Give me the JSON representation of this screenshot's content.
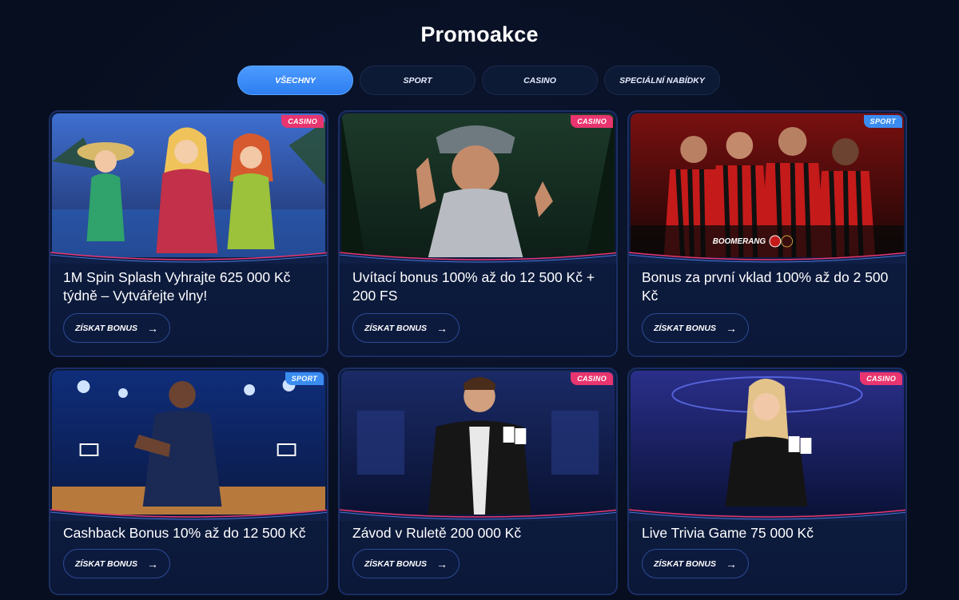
{
  "page": {
    "title": "Promoakce"
  },
  "tabs": [
    {
      "label": "VŠECHNY",
      "active": true
    },
    {
      "label": "SPORT",
      "active": false
    },
    {
      "label": "CASINO",
      "active": false
    },
    {
      "label": "SPECIÁLNÍ NABÍDKY",
      "active": false
    }
  ],
  "cards": [
    {
      "badge": "CASINO",
      "title": "1M Spin Splash Vyhrajte 625 000 Kč týdně – Vytvářejte vlny!",
      "cta": "ZÍSKAT BONUS",
      "image": "three-women-pool-party"
    },
    {
      "badge": "CASINO",
      "title": "Uvítací bonus 100% až do 12 500 Kč + 200 FS",
      "cta": "ZÍSKAT BONUS",
      "image": "conquistador-thumbs-up"
    },
    {
      "badge": "SPORT",
      "title": "Bonus za první vklad 100% až do 2 500 Kč",
      "cta": "ZÍSKAT BONUS",
      "image": "football-players-red-black",
      "logo_text": "BOOMERANG"
    },
    {
      "badge": "SPORT",
      "title": "Cashback Bonus 10% až do 12 500 Kč",
      "cta": "ZÍSKAT BONUS",
      "image": "basketball-player-arena"
    },
    {
      "badge": "CASINO",
      "title": "Závod v Ruletě 200 000 Kč",
      "cta": "ZÍSKAT BONUS",
      "image": "dealer-holding-cards"
    },
    {
      "badge": "CASINO",
      "title": "Live Trivia Game 75 000 Kč",
      "cta": "ZÍSKAT BONUS",
      "image": "woman-dealer-cards"
    }
  ],
  "icons": {
    "cta_arrow": "arrow-right-icon"
  },
  "colors": {
    "accent_blue": "#3a8cf0",
    "casino_pink": "#e8356f",
    "background": "#070e1f"
  }
}
